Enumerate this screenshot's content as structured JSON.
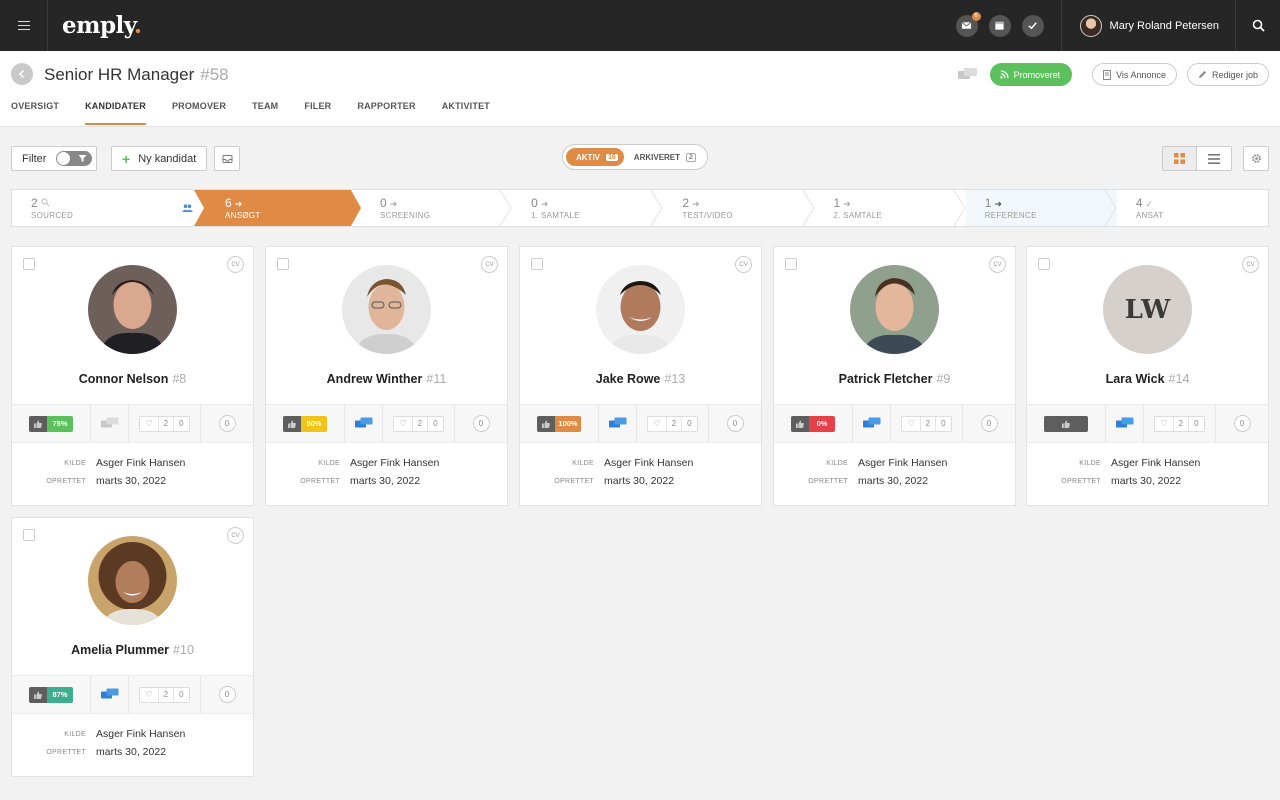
{
  "app": {
    "logo": "emply",
    "logo_dot": "."
  },
  "topbar": {
    "mail_badge": "6",
    "user_name": "Mary Roland Petersen"
  },
  "job": {
    "title": "Senior HR Manager",
    "number": "#58"
  },
  "tabs": [
    "OVERSIGT",
    "KANDIDATER",
    "PROMOVER",
    "TEAM",
    "FILER",
    "RAPPORTER",
    "AKTIVITET"
  ],
  "active_tab": "KANDIDATER",
  "header_buttons": {
    "promoted": "Promoveret",
    "view_ad": "Vis Annonce",
    "edit_job": "Rediger job"
  },
  "toolbar": {
    "filter_label": "Filter",
    "new_candidate": "Ny kandidat",
    "active_label": "AKTIV",
    "active_count": "16",
    "archived_label": "ARKIVERET",
    "archived_count": "2"
  },
  "pipeline": [
    {
      "count": "2",
      "label": "SOURCED",
      "icon": "search-icon"
    },
    {
      "count": "6",
      "label": "ANSØGT",
      "icon": "arrow-right-icon",
      "active": true
    },
    {
      "count": "0",
      "label": "SCREENING",
      "icon": "arrow-right-icon"
    },
    {
      "count": "0",
      "label": "1. SAMTALE",
      "icon": "arrow-right-icon"
    },
    {
      "count": "2",
      "label": "TEST/VIDEO",
      "icon": "arrow-right-icon"
    },
    {
      "count": "1",
      "label": "2. SAMTALE",
      "icon": "arrow-right-icon"
    },
    {
      "count": "1",
      "label": "REFERENCE",
      "icon": "arrow-right-icon"
    },
    {
      "count": "4",
      "label": "ANSAT",
      "icon": "check-icon"
    }
  ],
  "meta_labels": {
    "source": "KILDE",
    "created": "OPRETTET"
  },
  "candidates": [
    {
      "name": "Connor Nelson",
      "number": "#8",
      "score": "75%",
      "score_color": "#5cc15c",
      "likes": "2",
      "dislikes": "0",
      "comments": "0",
      "source": "Asger Fink Hansen",
      "created": "marts 30, 2022",
      "chat": false
    },
    {
      "name": "Andrew Winther",
      "number": "#11",
      "score": "50%",
      "score_color": "#f2c318",
      "likes": "2",
      "dislikes": "0",
      "comments": "0",
      "source": "Asger Fink Hansen",
      "created": "marts 30, 2022",
      "chat": true
    },
    {
      "name": "Jake Rowe",
      "number": "#13",
      "score": "100%",
      "score_color": "#e08b45",
      "likes": "2",
      "dislikes": "0",
      "comments": "0",
      "source": "Asger Fink Hansen",
      "created": "marts 30, 2022",
      "chat": true
    },
    {
      "name": "Patrick Fletcher",
      "number": "#9",
      "score": "0%",
      "score_color": "#e5414b",
      "likes": "2",
      "dislikes": "0",
      "comments": "0",
      "source": "Asger Fink Hansen",
      "created": "marts 30, 2022",
      "chat": true
    },
    {
      "name": "Lara Wick",
      "number": "#14",
      "initials": "LW",
      "score": "",
      "score_color": "#5e5e5e",
      "likes": "2",
      "dislikes": "0",
      "comments": "0",
      "source": "Asger Fink Hansen",
      "created": "marts 30, 2022",
      "chat": true
    },
    {
      "name": "Amelia Plummer",
      "number": "#10",
      "score": "87%",
      "score_color": "#3fae8e",
      "likes": "2",
      "dislikes": "0",
      "comments": "0",
      "source": "Asger Fink Hansen",
      "created": "marts 30, 2022",
      "chat": true
    }
  ],
  "cv_label": "CV"
}
